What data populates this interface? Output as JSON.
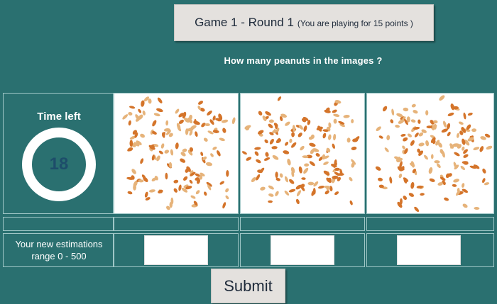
{
  "header": {
    "title": "Game 1 - Round 1",
    "subtitle": "(You are playing for 15 points )"
  },
  "question": "How many peanuts in the images ?",
  "timer": {
    "label": "Time left",
    "value": "18"
  },
  "images": [
    {
      "name": "peanut-image-1"
    },
    {
      "name": "peanut-image-2"
    },
    {
      "name": "peanut-image-3"
    }
  ],
  "estimation": {
    "label_line1": "Your new estimations",
    "label_line2": "range 0 - 500",
    "values": [
      "",
      "",
      ""
    ]
  },
  "submit_label": "Submit",
  "colors": {
    "background": "#2a7070",
    "panel": "#e4e1de",
    "peanut_dark": "#d4742a",
    "peanut_light": "#e6b37a"
  }
}
